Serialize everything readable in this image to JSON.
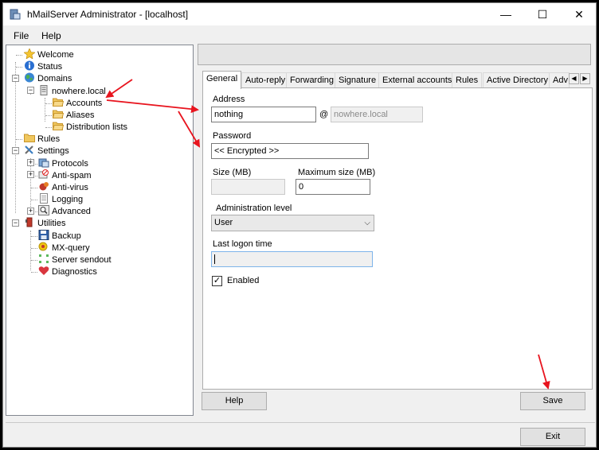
{
  "window": {
    "title": "hMailServer Administrator - [localhost]",
    "controls": {
      "minimize": "—",
      "maximize": "☐",
      "close": "✕"
    }
  },
  "menu": [
    "File",
    "Help"
  ],
  "tree": {
    "welcome": "Welcome",
    "status": "Status",
    "domains": "Domains",
    "domain": "nowhere.local",
    "accounts": "Accounts",
    "aliases": "Aliases",
    "distribution_lists": "Distribution lists",
    "rules": "Rules",
    "settings": "Settings",
    "protocols": "Protocols",
    "anti_spam": "Anti-spam",
    "anti_virus": "Anti-virus",
    "logging": "Logging",
    "advanced": "Advanced",
    "utilities": "Utilities",
    "backup": "Backup",
    "mx_query": "MX-query",
    "server_sendout": "Server sendout",
    "diagnostics": "Diagnostics"
  },
  "tabs": [
    "General",
    "Auto-reply",
    "Forwarding",
    "Signature",
    "External accounts",
    "Rules",
    "Active Directory",
    "Adv"
  ],
  "active_tab": "General",
  "form": {
    "address_label": "Address",
    "address_value": "nothing",
    "at_sign": "@",
    "domain_value": "nowhere.local",
    "password_label": "Password",
    "password_value": "<< Encrypted >>",
    "size_label": "Size (MB)",
    "size_value": "",
    "max_size_label": "Maximum size (MB)",
    "max_size_value": "0",
    "admin_level_label": "Administration level",
    "admin_level_value": "User",
    "last_logon_label": "Last logon time",
    "last_logon_value": "",
    "enabled_label": "Enabled",
    "enabled_checked": true
  },
  "buttons": {
    "help": "Help",
    "save": "Save",
    "exit": "Exit"
  },
  "colors": {
    "annotation_arrow": "#e8141e"
  }
}
